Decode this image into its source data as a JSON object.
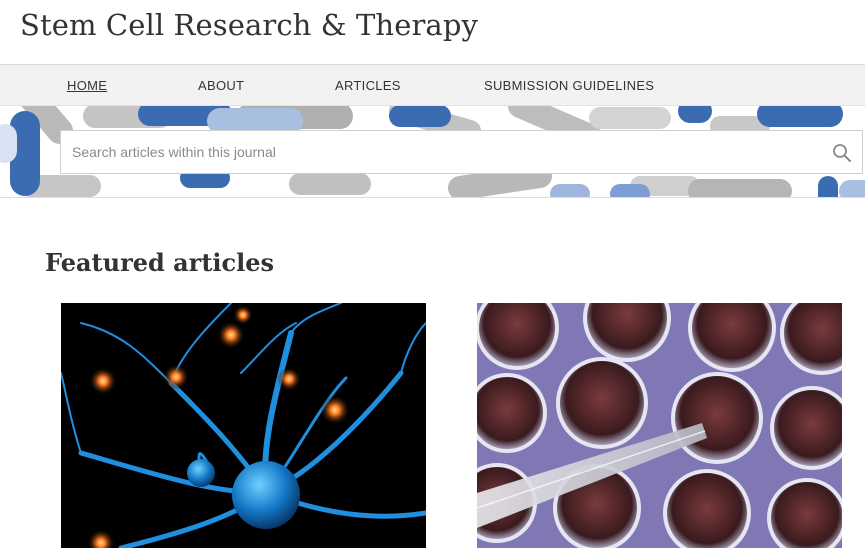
{
  "journal": {
    "title": "Stem Cell Research & Therapy"
  },
  "nav": {
    "items": [
      {
        "label": "HOME",
        "active": true
      },
      {
        "label": "ABOUT",
        "active": false
      },
      {
        "label": "ARTICLES",
        "active": false
      },
      {
        "label": "SUBMISSION GUIDELINES",
        "active": false
      }
    ]
  },
  "search": {
    "placeholder": "Search articles within this journal",
    "value": "",
    "icon": "search-icon"
  },
  "featured": {
    "heading": "Featured articles",
    "articles": [
      {
        "image": "neuron-network-illustration"
      },
      {
        "image": "cell-culture-well-plate-with-pipette"
      }
    ]
  },
  "colors": {
    "nav_background": "#f2f2f2",
    "banner_blue": "#3b6bb0",
    "banner_light_blue": "#a8bfe0",
    "banner_gray": "#b9b9b9",
    "text": "#333333"
  }
}
